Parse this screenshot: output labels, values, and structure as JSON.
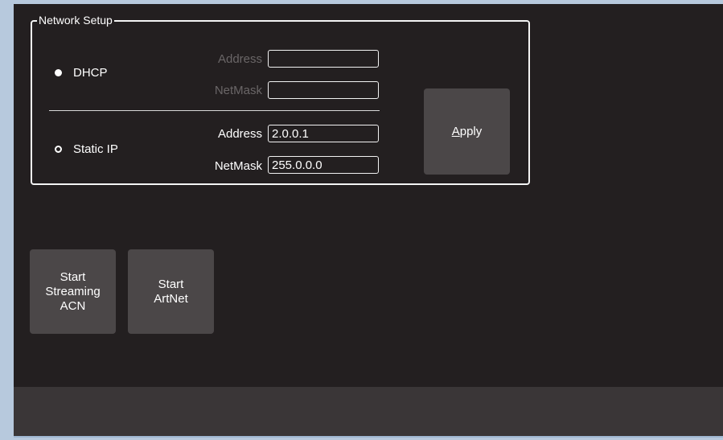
{
  "network_setup": {
    "title": "Network Setup",
    "dhcp": {
      "label": "DHCP",
      "selected": true,
      "address_label": "Address",
      "address_value": "",
      "netmask_label": "NetMask",
      "netmask_value": ""
    },
    "static_ip": {
      "label": "Static IP",
      "selected": false,
      "address_label": "Address",
      "address_value": "2.0.0.1",
      "netmask_label": "NetMask",
      "netmask_value": "255.0.0.0"
    },
    "apply_button": {
      "mnemonic": "A",
      "rest": "pply"
    }
  },
  "actions": {
    "start_acn_label": "Start\nStreaming\nACN",
    "start_artnet_label": "Start\nArtNet"
  },
  "colors": {
    "background": "#231f20",
    "button": "#4b4748",
    "status_bar": "#3a3637",
    "disabled_text": "#6a6667"
  }
}
